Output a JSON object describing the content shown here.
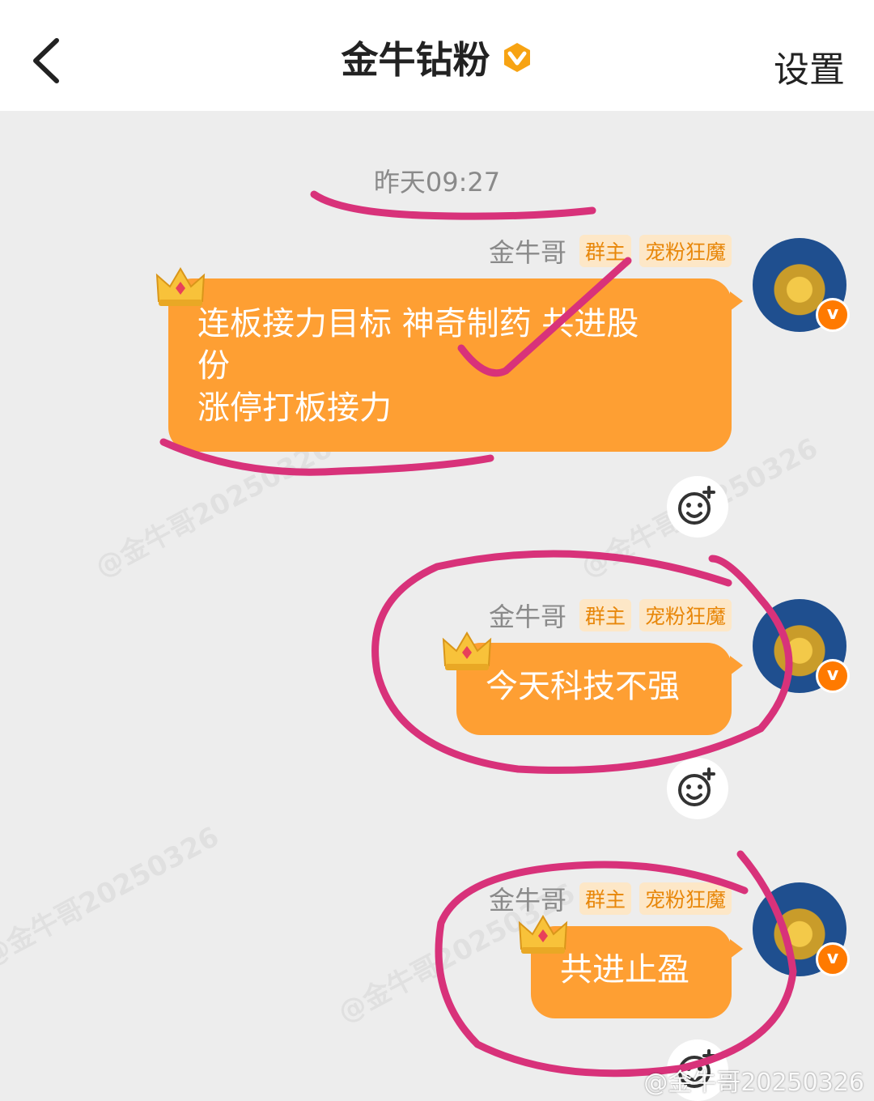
{
  "header": {
    "back_icon": "chevron-left-icon",
    "title": "金牛钻粉",
    "verified_icon": "v-badge-icon",
    "settings_label": "设置"
  },
  "chat": {
    "timestamp": "昨天09:27",
    "messages": [
      {
        "sender": "金牛哥",
        "tags": [
          "群主",
          "宠粉狂魔"
        ],
        "lines": [
          "连板接力目标 神奇制药 共进股",
          "份",
          "涨停打板接力"
        ]
      },
      {
        "sender": "金牛哥",
        "tags": [
          "群主",
          "宠粉狂魔"
        ],
        "lines": [
          "今天科技不强"
        ]
      },
      {
        "sender": "金牛哥",
        "tags": [
          "群主",
          "宠粉狂魔"
        ],
        "lines": [
          "共进止盈"
        ]
      }
    ]
  },
  "watermarks": [
    "@金牛哥20250326",
    "@金牛哥20250326",
    "@金牛哥20250326",
    "@金牛哥20250326"
  ],
  "footer_watermark": "@金牛哥20250326",
  "colors": {
    "bubble": "#fe9f33",
    "tag_bg": "#fde7c7",
    "tag_text": "#e8870a",
    "annotation": "#d8327a"
  }
}
